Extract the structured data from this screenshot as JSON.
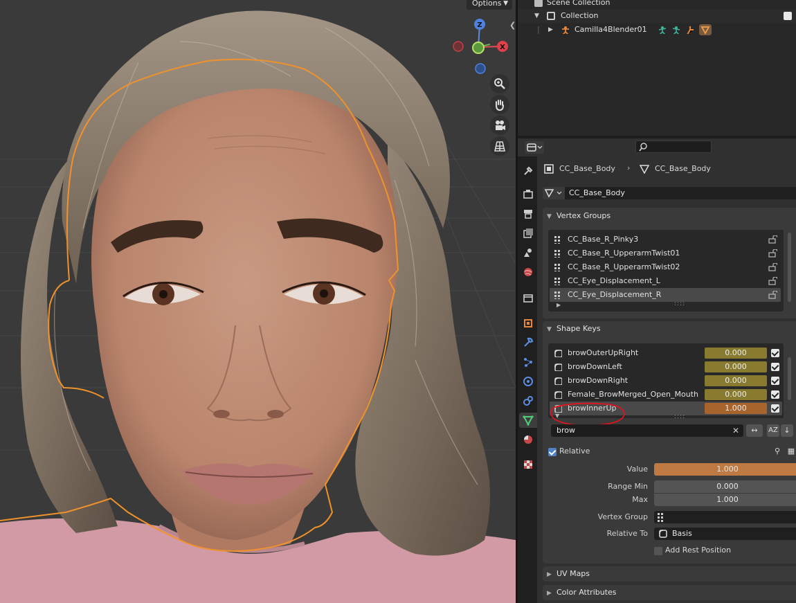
{
  "viewport": {
    "options_label": "Options",
    "gizmo": {
      "z": "Z",
      "x": "X"
    },
    "tools": [
      "zoom-icon",
      "hand-icon",
      "camera-icon",
      "grid-icon"
    ]
  },
  "outliner": {
    "scene_collection": "Scene Collection",
    "collection": "Collection",
    "object": "Camilla4Blender01"
  },
  "properties": {
    "breadcrumb": {
      "object": "CC_Base_Body",
      "mesh": "CC_Base_Body"
    },
    "mesh_name": "CC_Base_Body",
    "vertex_groups": {
      "title": "Vertex Groups",
      "items": [
        "CC_Base_R_Pinky3",
        "CC_Base_R_UpperarmTwist01",
        "CC_Base_R_UpperarmTwist02",
        "CC_Eye_Displacement_L",
        "CC_Eye_Displacement_R"
      ],
      "selected_index": 4
    },
    "shape_keys": {
      "title": "Shape Keys",
      "items": [
        {
          "name": "browOuterUpRight",
          "value": "0.000"
        },
        {
          "name": "browDownLeft",
          "value": "0.000"
        },
        {
          "name": "browDownRight",
          "value": "0.000"
        },
        {
          "name": "Female_BrowMerged_Open_Mouth",
          "value": "0.000"
        },
        {
          "name": "browInnerUp",
          "value": "1.000"
        }
      ],
      "selected_index": 4,
      "filter_text": "brow",
      "sort_label": "AZ",
      "relative_label": "Relative",
      "value_label": "Value",
      "value": "1.000",
      "range_min_label": "Range Min",
      "range_min": "0.000",
      "max_label": "Max",
      "max": "1.000",
      "vertex_group_label": "Vertex Group",
      "relative_to_label": "Relative To",
      "relative_to": "Basis",
      "add_rest_label": "Add Rest Position"
    },
    "uv_maps_title": "UV Maps",
    "color_attributes_title": "Color Attributes"
  },
  "colors": {
    "selection_outline": "#f0922b",
    "annotation_red": "#e0141e",
    "active_orange": "#bf7a43",
    "value_olive": "#887b2f"
  }
}
